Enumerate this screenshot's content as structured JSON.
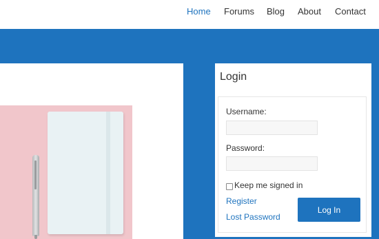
{
  "nav": {
    "items": [
      {
        "label": "Home",
        "active": true
      },
      {
        "label": "Forums",
        "active": false
      },
      {
        "label": "Blog",
        "active": false
      },
      {
        "label": "About",
        "active": false
      },
      {
        "label": "Contact",
        "active": false
      }
    ]
  },
  "login": {
    "title": "Login",
    "username_label": "Username:",
    "username_value": "",
    "password_label": "Password:",
    "password_value": "",
    "remember_label": "Keep me signed in",
    "remember_checked": false,
    "register_link": "Register",
    "lost_password_link": "Lost Password",
    "submit_label": "Log In"
  },
  "colors": {
    "accent": "#1e73be",
    "photo_background": "#f1c6cb"
  }
}
